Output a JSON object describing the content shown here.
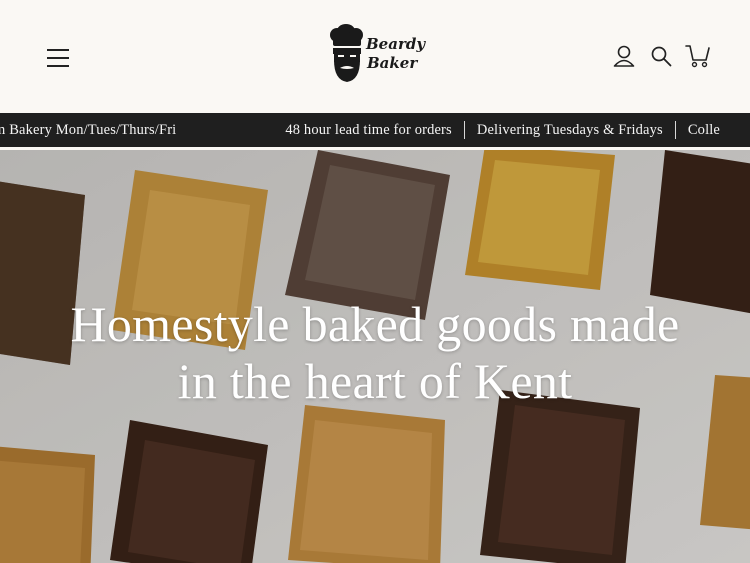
{
  "header": {
    "brand_line1": "Beardy",
    "brand_line2": "Baker",
    "menu_icon": "hamburger-menu-icon",
    "account_icon": "account-icon",
    "search_icon": "search-icon",
    "cart_icon": "cart-icon"
  },
  "announcement": {
    "items": [
      "m Bakery Mon/Tues/Thurs/Fri",
      "48 hour lead time for orders",
      "Delivering Tuesdays & Fridays",
      "Colle"
    ]
  },
  "hero": {
    "title_line1": "Homestyle baked goods made",
    "title_line2": "in the heart of Kent"
  },
  "colors": {
    "background": "#faf8f4",
    "announcement_bar": "#1f1f1f",
    "text_dark": "#222222"
  }
}
